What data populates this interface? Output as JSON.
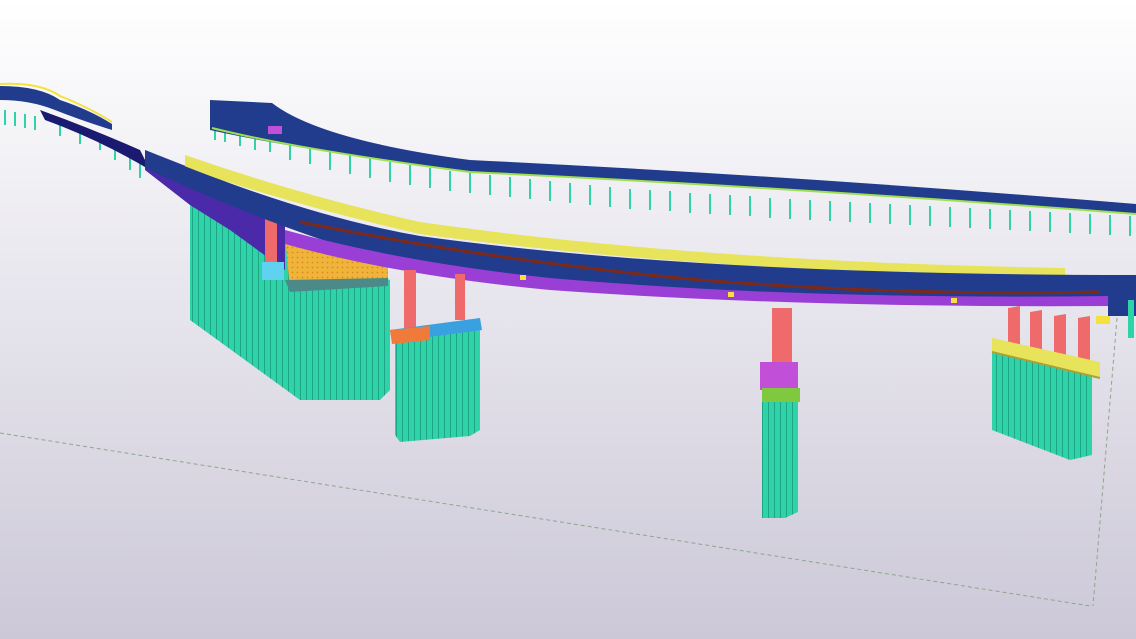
{
  "viewport": {
    "background_top": "#ffffff",
    "background_bottom": "#ccc8d8"
  },
  "colors": {
    "deck_blue": "#213c8c",
    "deck_dark": "#1a1a70",
    "girder_purple": "#9a3fd6",
    "violet": "#4a2aa8",
    "pile_teal": "#2ed4a8",
    "pile_dark": "#1ea487",
    "pier_red": "#ef6a6a",
    "cap_yellow": "#e7e35a",
    "cap_orange": "#f0b43a",
    "bearing_yellow": "#f4e23c",
    "ground_line": "#8fa58f"
  },
  "model": {
    "elements": [
      "far-deck",
      "near-deck",
      "abutment-left",
      "pier-1",
      "pier-2",
      "pier-3",
      "boundary-lines"
    ]
  }
}
